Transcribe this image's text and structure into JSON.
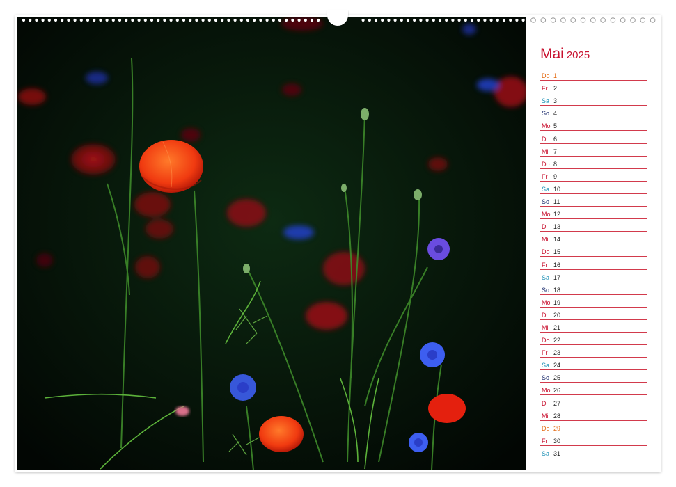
{
  "calendar": {
    "month": "Mai",
    "year": "2025",
    "colors": {
      "title": "#c8102e",
      "line": "#d23a4c",
      "weekday": "#c8102e",
      "saturday": "#1a8fb5",
      "sunday": "#1a2a6c",
      "holiday": "#e36a12"
    },
    "days": [
      {
        "wd": "Do",
        "num": "1",
        "type": "holiday"
      },
      {
        "wd": "Fr",
        "num": "2",
        "type": "weekday"
      },
      {
        "wd": "Sa",
        "num": "3",
        "type": "saturday"
      },
      {
        "wd": "So",
        "num": "4",
        "type": "sunday"
      },
      {
        "wd": "Mo",
        "num": "5",
        "type": "weekday"
      },
      {
        "wd": "Di",
        "num": "6",
        "type": "weekday"
      },
      {
        "wd": "Mi",
        "num": "7",
        "type": "weekday"
      },
      {
        "wd": "Do",
        "num": "8",
        "type": "weekday"
      },
      {
        "wd": "Fr",
        "num": "9",
        "type": "weekday"
      },
      {
        "wd": "Sa",
        "num": "10",
        "type": "saturday"
      },
      {
        "wd": "So",
        "num": "11",
        "type": "sunday"
      },
      {
        "wd": "Mo",
        "num": "12",
        "type": "weekday"
      },
      {
        "wd": "Di",
        "num": "13",
        "type": "weekday"
      },
      {
        "wd": "Mi",
        "num": "14",
        "type": "weekday"
      },
      {
        "wd": "Do",
        "num": "15",
        "type": "weekday"
      },
      {
        "wd": "Fr",
        "num": "16",
        "type": "weekday"
      },
      {
        "wd": "Sa",
        "num": "17",
        "type": "saturday"
      },
      {
        "wd": "So",
        "num": "18",
        "type": "sunday"
      },
      {
        "wd": "Mo",
        "num": "19",
        "type": "weekday"
      },
      {
        "wd": "Di",
        "num": "20",
        "type": "weekday"
      },
      {
        "wd": "Mi",
        "num": "21",
        "type": "weekday"
      },
      {
        "wd": "Do",
        "num": "22",
        "type": "weekday"
      },
      {
        "wd": "Fr",
        "num": "23",
        "type": "weekday"
      },
      {
        "wd": "Sa",
        "num": "24",
        "type": "saturday"
      },
      {
        "wd": "So",
        "num": "25",
        "type": "sunday"
      },
      {
        "wd": "Mo",
        "num": "26",
        "type": "weekday"
      },
      {
        "wd": "Di",
        "num": "27",
        "type": "weekday"
      },
      {
        "wd": "Mi",
        "num": "28",
        "type": "weekday"
      },
      {
        "wd": "Do",
        "num": "29",
        "type": "holiday"
      },
      {
        "wd": "Fr",
        "num": "30",
        "type": "weekday"
      },
      {
        "wd": "Sa",
        "num": "31",
        "type": "saturday"
      }
    ]
  }
}
